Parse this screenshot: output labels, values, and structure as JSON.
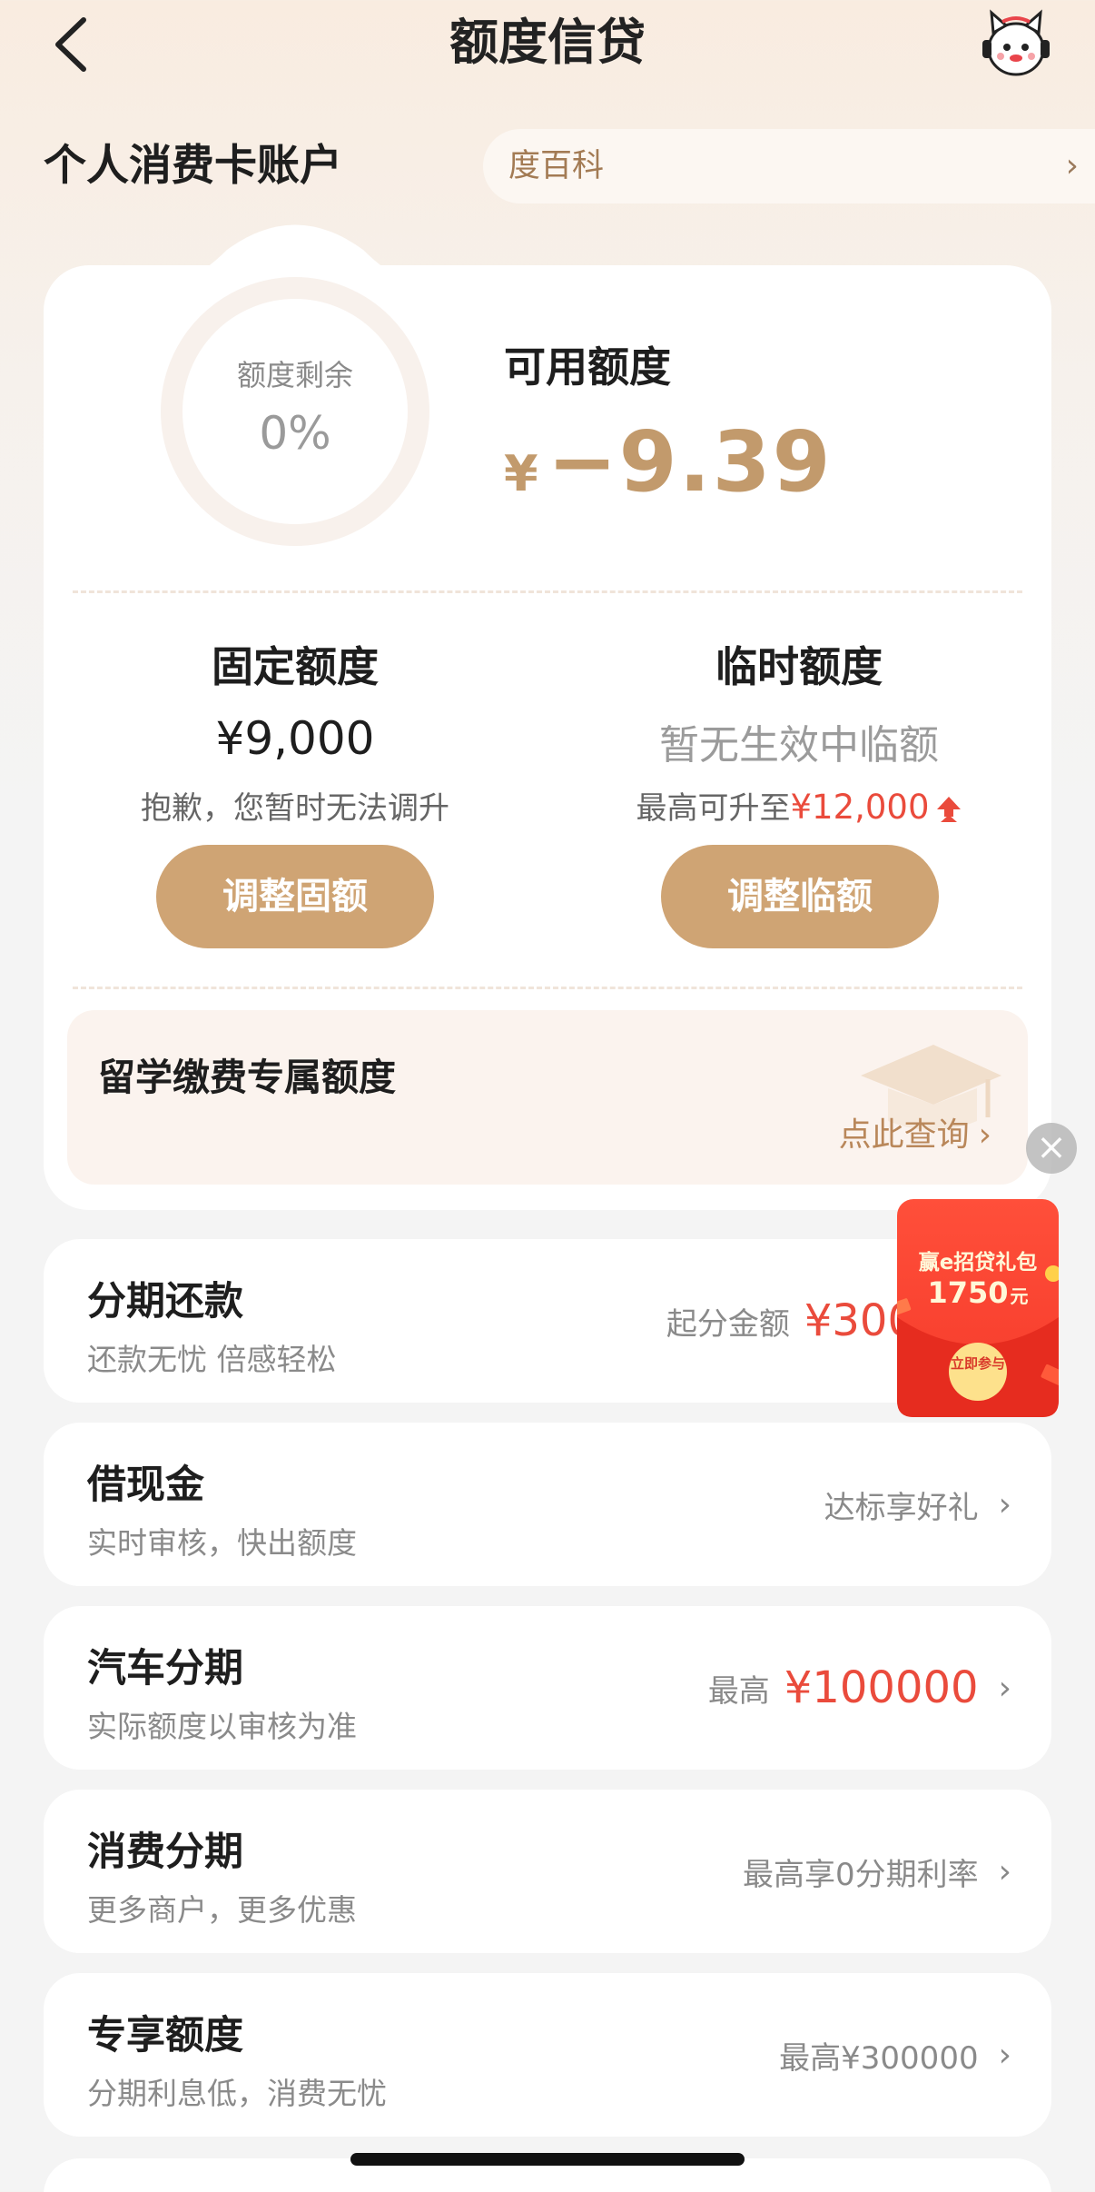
{
  "header": {
    "title": "额度信贷"
  },
  "account": {
    "title": "个人消费卡账户",
    "marquee_text": "度百科",
    "marquee_chevron": "›"
  },
  "quota": {
    "ring_label": "额度剩余",
    "ring_value": "0%",
    "ring_fraction": 0,
    "available_label": "可用额度",
    "available_currency": "¥",
    "available_value": "−9.39"
  },
  "fixed": {
    "title": "固定额度",
    "amount": "¥9,000",
    "note": "抱歉，您暂时无法调升",
    "button": "调整固额"
  },
  "temporary": {
    "title": "临时额度",
    "status": "暂无生效中临额",
    "note_prefix": "最高可升至",
    "note_amount": "¥12,000",
    "button": "调整临额"
  },
  "study": {
    "title": "留学缴费专属额度",
    "link": "点此查询",
    "chevron": "›"
  },
  "items": [
    {
      "title": "分期还款",
      "sub": "还款无忧 倍感轻松",
      "right_label": "起分金额",
      "right_amount": "¥300",
      "chevron": ""
    },
    {
      "title": "借现金",
      "sub": "实时审核，快出额度",
      "right_label": "达标享好礼",
      "right_amount": "",
      "chevron": "›"
    },
    {
      "title": "汽车分期",
      "sub": "实际额度以审核为准",
      "right_label": "最高",
      "right_amount": "¥100000",
      "chevron": "›"
    },
    {
      "title": "消费分期",
      "sub": "更多商户，更多优惠",
      "right_label": "最高享0分期利率",
      "right_amount": "",
      "chevron": "›"
    },
    {
      "title": "专享额度",
      "sub": "分期利息低，消费无忧",
      "right_label": "最高¥300000",
      "right_amount": "",
      "chevron": "›"
    }
  ],
  "promo": {
    "line1": "赢e招贷礼包",
    "amount": "1750",
    "unit": "元",
    "button": "立即参与",
    "close": "×"
  },
  "colors": {
    "accent_gold": "#cfa474",
    "amount_gold": "#c29a6c",
    "red": "#ea4b3c",
    "promo_red": "#f53a2a"
  }
}
